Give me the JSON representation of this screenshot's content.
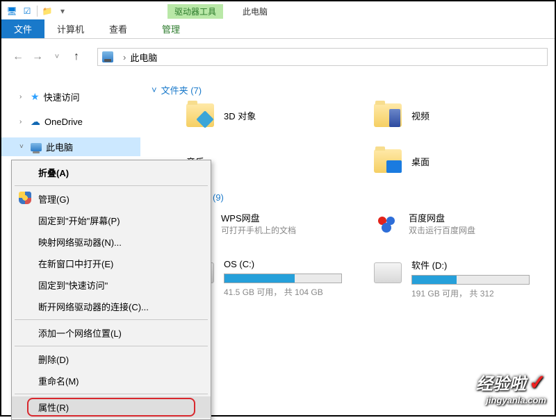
{
  "titlebar": {
    "drive_tools": "驱动器工具",
    "app_name": "此电脑"
  },
  "ribbon": {
    "file": "文件",
    "computer": "计算机",
    "view": "查看",
    "manage": "管理"
  },
  "address": {
    "location": "此电脑",
    "chevron": "›"
  },
  "sidebar": {
    "quick_access": "快速访问",
    "onedrive": "OneDrive",
    "this_pc": "此电脑"
  },
  "sections": {
    "folders_header": "文件夹 (7)",
    "devices_header": "(9)"
  },
  "folders": {
    "objects3d": "3D 对象",
    "videos": "视频",
    "music": "音乐",
    "desktop": "桌面"
  },
  "apps": {
    "wps": {
      "label": "WPS网盘",
      "sub": "可打开手机上的文档"
    },
    "baidu": {
      "label": "百度网盘",
      "sub": "双击运行百度网盘"
    }
  },
  "drives": {
    "c": {
      "label": "OS (C:)",
      "free_text": "41.5 GB 可用， 共 104 GB",
      "fill_pct": 60
    },
    "d": {
      "label": "软件 (D:)",
      "free_text": "191 GB 可用， 共 312",
      "fill_pct": 38
    }
  },
  "ctx": {
    "collapse": "折叠(A)",
    "manage": "管理(G)",
    "pin_start": "固定到\"开始\"屏幕(P)",
    "map_drive": "映射网络驱动器(N)...",
    "open_new_window": "在新窗口中打开(E)",
    "pin_quick": "固定到\"快速访问\"",
    "disconnect": "断开网络驱动器的连接(C)...",
    "add_network_location": "添加一个网络位置(L)",
    "delete": "删除(D)",
    "rename": "重命名(M)",
    "properties": "属性(R)"
  },
  "watermark": {
    "big": "经验啦",
    "small": "jingyanla.com",
    "check": "✓"
  }
}
